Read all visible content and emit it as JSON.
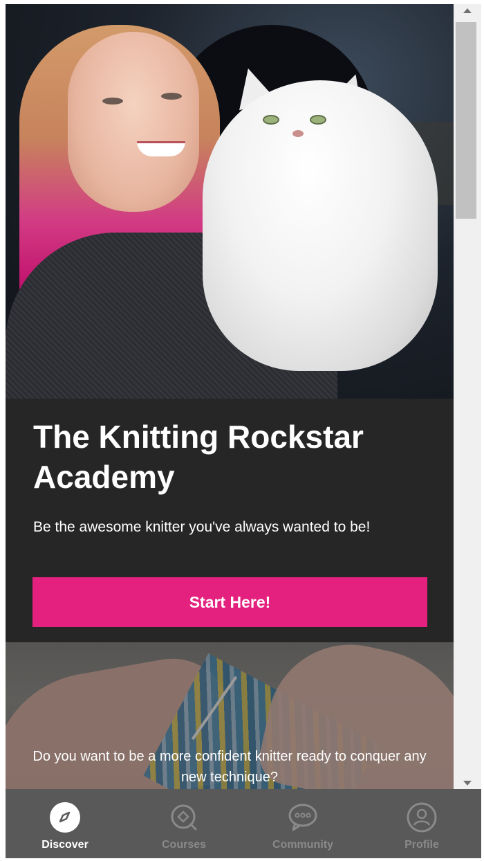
{
  "hero": {
    "image_alt": "Woman with pink hair holding a white Persian cat"
  },
  "intro": {
    "title": "The Knitting Rockstar Academy",
    "subtitle": "Be the awesome knitter you've always wanted to be!",
    "cta_label": "Start Here!"
  },
  "banner": {
    "text": "Do you want to be a more confident knitter ready to conquer any new technique?"
  },
  "nav": {
    "items": [
      {
        "label": "Discover",
        "icon": "compass-icon",
        "active": true
      },
      {
        "label": "Courses",
        "icon": "courses-icon",
        "active": false
      },
      {
        "label": "Community",
        "icon": "chat-bubble-icon",
        "active": false
      },
      {
        "label": "Profile",
        "icon": "user-icon",
        "active": false
      }
    ]
  },
  "colors": {
    "accent": "#e4217e",
    "panel": "#262626",
    "nav_bg": "#595959",
    "nav_inactive": "#8a8a8a",
    "nav_active": "#ffffff"
  }
}
